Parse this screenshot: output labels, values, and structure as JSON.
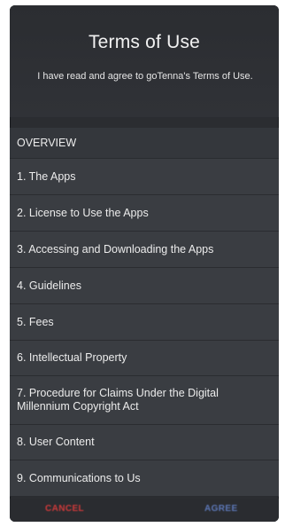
{
  "header": {
    "title": "Terms of Use",
    "subtitle": "I have read and agree to goTenna's Terms of Use."
  },
  "sections": [
    "OVERVIEW",
    "1. The Apps",
    "2. License to Use the Apps",
    "3. Accessing and Downloading the Apps",
    "4. Guidelines",
    "5. Fees",
    "6. Intellectual Property",
    "7. Procedure for Claims Under the Digital Millennium Copyright Act",
    "8. User Content",
    "9. Communications to Us"
  ],
  "footer": {
    "cancel_label": "CANCEL",
    "agree_label": "AGREE"
  },
  "colors": {
    "cancel": "#d13a3a",
    "agree": "#5d78b8",
    "background": "#2b2d31",
    "list_background": "#3a3d42"
  }
}
